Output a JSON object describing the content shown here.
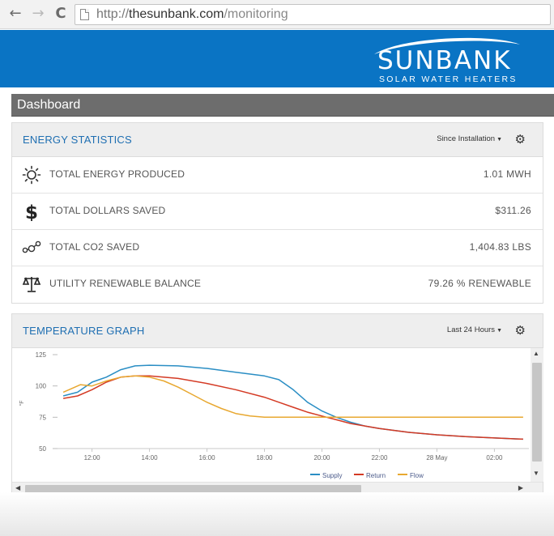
{
  "browser": {
    "url_scheme": "http://",
    "url_host": "thesunbank.com",
    "url_path": "/monitoring",
    "back_glyph": "←",
    "forward_glyph": "→",
    "reload_glyph": "C"
  },
  "brand": {
    "name": "SUNBANK",
    "tagline": "SOLAR WATER HEATERS"
  },
  "dashboard": {
    "title": "Dashboard"
  },
  "energy": {
    "title": "ENERGY STATISTICS",
    "range": "Since Installation",
    "stats": [
      {
        "icon": "sun-icon",
        "label": "TOTAL ENERGY PRODUCED",
        "value": "1.01 MWH"
      },
      {
        "icon": "dollar-icon",
        "label": "TOTAL DOLLARS SAVED",
        "value": "$311.26"
      },
      {
        "icon": "molecule-icon",
        "label": "TOTAL CO2 SAVED",
        "value": "1,404.83 LBS"
      },
      {
        "icon": "scale-icon",
        "label": "UTILITY RENEWABLE BALANCE",
        "value": "79.26 % RENEWABLE"
      }
    ]
  },
  "temperature": {
    "title": "TEMPERATURE GRAPH",
    "range": "Last 24 Hours"
  },
  "colors": {
    "supply": "#2a8ec4",
    "return": "#d43a24",
    "flow": "#e8a830",
    "header": "#0a74c4"
  },
  "chart_data": {
    "type": "line",
    "xlabel": "",
    "ylabel": "°F",
    "ylim": [
      50,
      125
    ],
    "yticks": [
      "125",
      "100",
      "75",
      "50"
    ],
    "xtick_labels": [
      "12:00",
      "14:00",
      "16:00",
      "18:00",
      "20:00",
      "22:00",
      "28 May",
      "02:00"
    ],
    "xlim": [
      10.8,
      27.2
    ],
    "legend_position": "bottom",
    "series": [
      {
        "name": "Supply",
        "color": "#2a8ec4",
        "x": [
          11.0,
          11.5,
          12.0,
          12.5,
          13.0,
          13.5,
          14.0,
          15.0,
          16.0,
          17.0,
          18.0,
          18.5,
          19.0,
          19.5,
          20.0,
          20.5,
          21.0,
          21.5,
          22.0,
          23.0,
          24.0,
          25.0,
          26.0,
          27.0
        ],
        "y": [
          92,
          95,
          103,
          107,
          113,
          116,
          116.5,
          116,
          114,
          111,
          108,
          105,
          97,
          87,
          80,
          75,
          71,
          68,
          66,
          63,
          61,
          59.5,
          58.5,
          57.5
        ]
      },
      {
        "name": "Return",
        "color": "#d43a24",
        "x": [
          11.0,
          11.5,
          12.0,
          12.5,
          13.0,
          13.5,
          14.0,
          15.0,
          16.0,
          17.0,
          18.0,
          18.5,
          19.0,
          19.5,
          20.0,
          20.5,
          21.0,
          22.0,
          23.0,
          24.0,
          25.0,
          26.0,
          27.0
        ],
        "y": [
          90,
          92,
          97,
          103,
          107,
          108,
          108,
          106,
          102,
          97,
          91,
          87,
          83,
          79,
          76,
          73,
          70,
          66,
          63,
          61,
          59.5,
          58.5,
          57.5
        ]
      },
      {
        "name": "Flow",
        "color": "#e8a830",
        "x": [
          11.0,
          11.3,
          11.6,
          12.0,
          12.5,
          13.0,
          13.5,
          14.0,
          14.5,
          15.0,
          15.5,
          16.0,
          16.5,
          17.0,
          17.5,
          18.0,
          18.5,
          19.0,
          20.0,
          27.0
        ],
        "y": [
          95,
          98,
          101,
          100,
          104,
          107,
          108,
          107,
          104,
          99,
          93,
          87,
          82,
          78,
          76,
          75,
          75,
          75,
          75,
          75
        ]
      }
    ]
  }
}
